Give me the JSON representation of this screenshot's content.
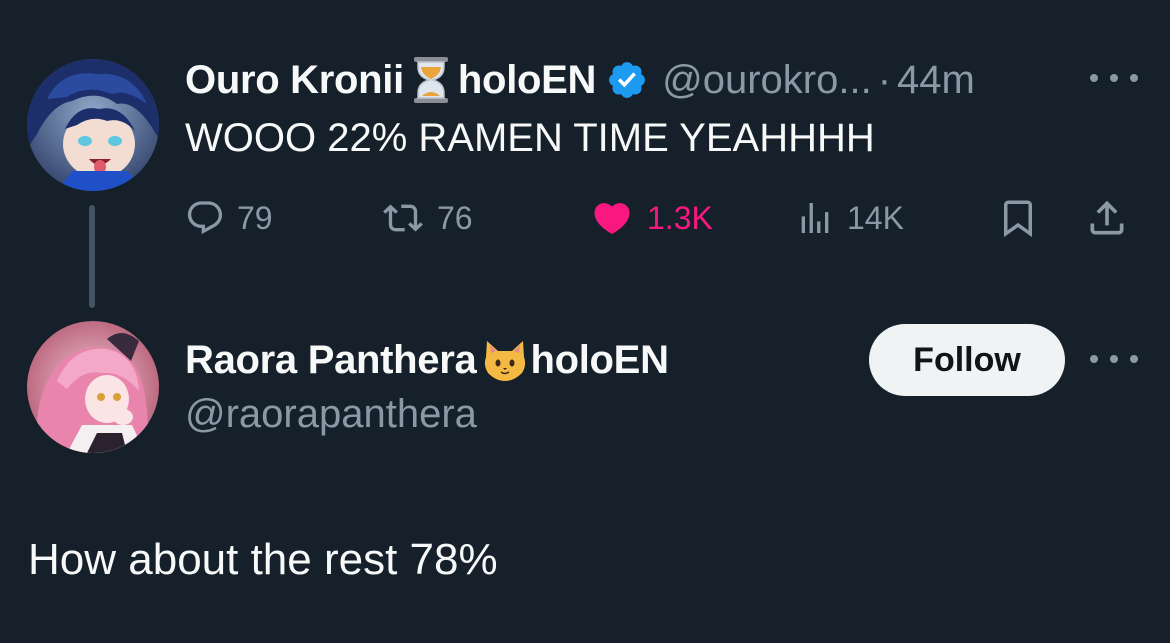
{
  "parent_tweet": {
    "display_name": "Ouro Kronii",
    "name_emoji": "hourglass-icon",
    "name_suffix": "holoEN",
    "verified": true,
    "handle": "@ourokro...",
    "separator": "·",
    "time": "44m",
    "text": "WOOO 22% RAMEN TIME YEAHHHH",
    "stats": {
      "replies": "79",
      "reposts": "76",
      "likes": "1.3K",
      "views": "14K"
    }
  },
  "reply_author": {
    "display_name": "Raora Panthera",
    "name_emoji": "cat-face-icon",
    "name_suffix": "holoEN",
    "handle": "@raorapanthera",
    "follow_label": "Follow"
  },
  "reply": {
    "text": "How about the rest 78%"
  },
  "colors": {
    "background": "#15202b",
    "text_primary": "#f7f9f9",
    "text_secondary": "#8b98a5",
    "like_active": "#f91880",
    "verified_blue": "#1d9bf0",
    "follow_button_bg": "#eff3f4"
  }
}
